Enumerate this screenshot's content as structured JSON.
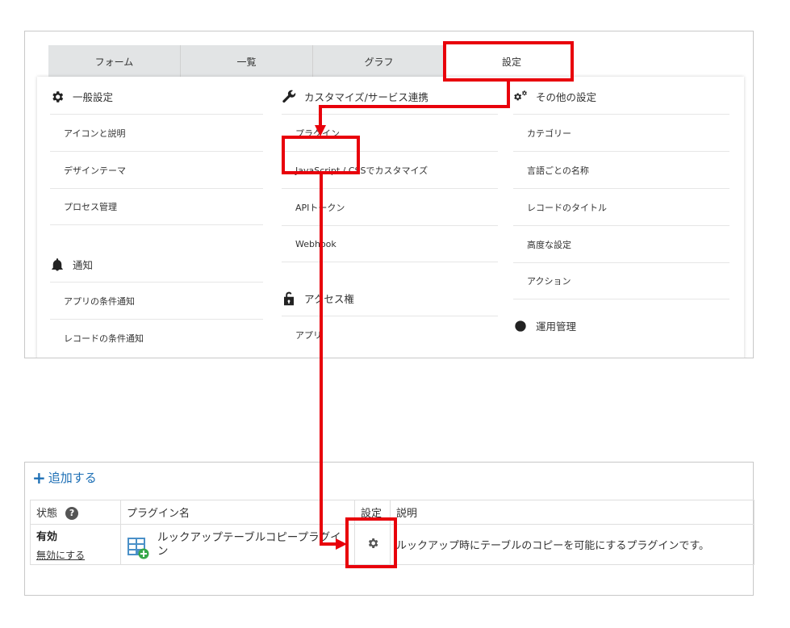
{
  "tabs": [
    {
      "label": "フォーム"
    },
    {
      "label": "一覧"
    },
    {
      "label": "グラフ"
    },
    {
      "label": "設定",
      "active": true
    }
  ],
  "menu": {
    "general": {
      "title": "一般設定",
      "items": [
        "アイコンと説明",
        "デザインテーマ",
        "プロセス管理"
      ]
    },
    "notify": {
      "title": "通知",
      "items": [
        "アプリの条件通知",
        "レコードの条件通知"
      ]
    },
    "customize": {
      "title": "カスタマイズ/サービス連携",
      "items": [
        "プラグイン",
        "JavaScript / CSSでカスタマイズ",
        "APIトークン",
        "Webhook"
      ]
    },
    "access": {
      "title": "アクセス権",
      "items": [
        "アプリ"
      ]
    },
    "other": {
      "title": "その他の設定",
      "items": [
        "カテゴリー",
        "言語ごとの名称",
        "レコードのタイトル",
        "高度な設定",
        "アクション"
      ]
    },
    "ops": {
      "title": "運用管理"
    }
  },
  "plugins": {
    "add_label": "追加する",
    "headers": {
      "status": "状態",
      "name": "プラグイン名",
      "settings": "設定",
      "description": "説明"
    },
    "rows": [
      {
        "status": "有効",
        "disable_link": "無効にする",
        "name": "ルックアップテーブルコピープラグイン",
        "description": "ルックアップ時にテーブルのコピーを可能にするプラグインです。"
      }
    ]
  },
  "colors": {
    "highlight": "#e8000b",
    "link": "#1d6fb5",
    "tab_inactive": "#e2e4e5"
  },
  "icons": [
    "gear-icon",
    "wrench-icon",
    "gears-icon",
    "bell-icon",
    "unlock-icon",
    "help-icon",
    "plugin-table-icon",
    "settings-gear-icon"
  ]
}
